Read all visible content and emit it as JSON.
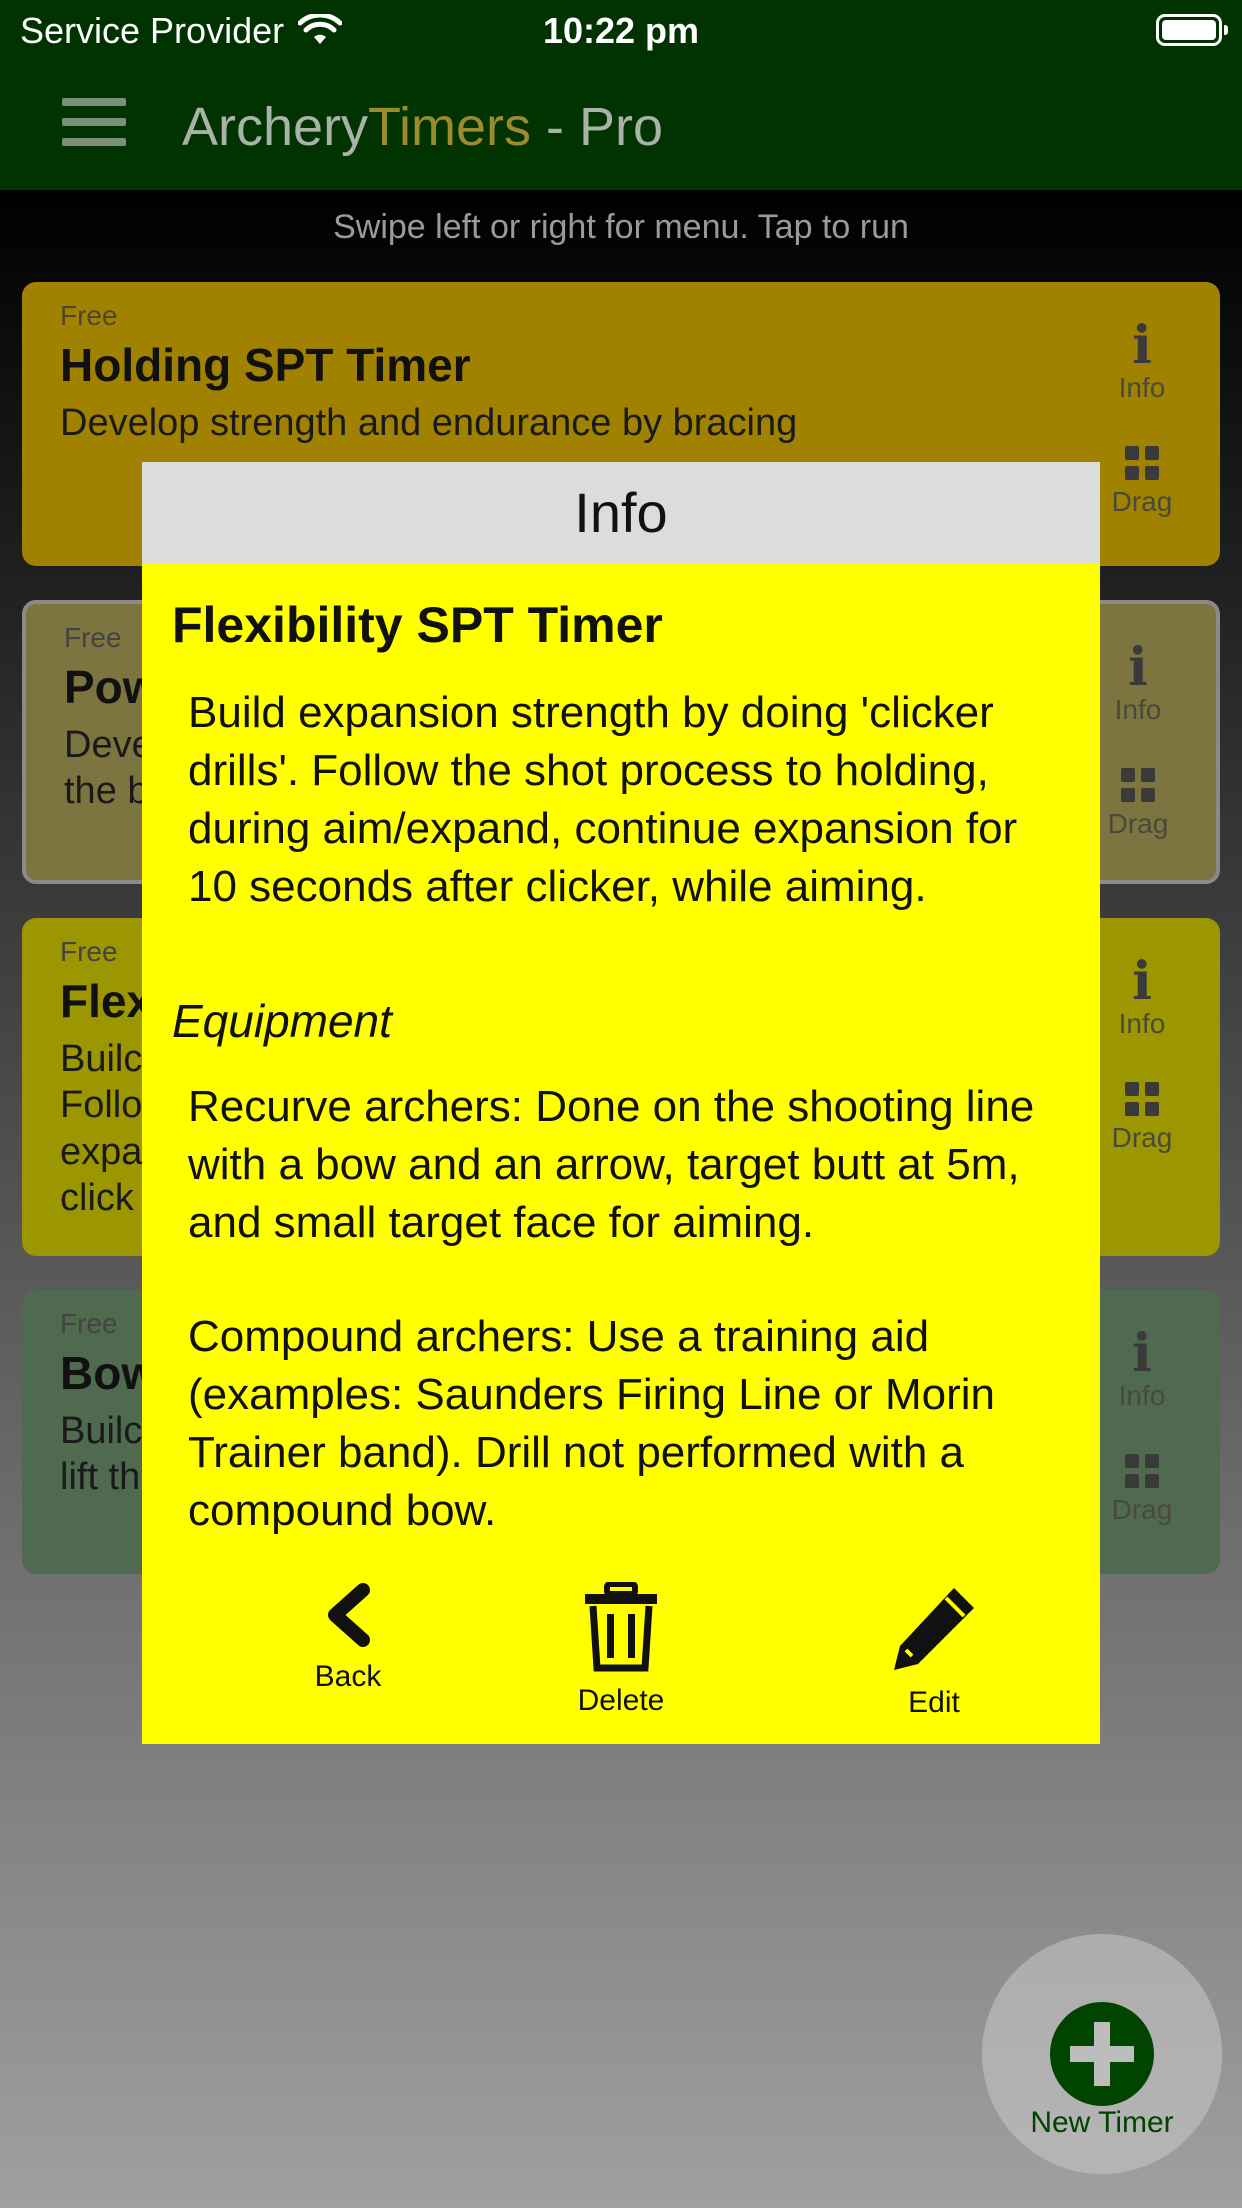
{
  "status_bar": {
    "carrier": "Service Provider",
    "time": "10:22 pm",
    "wifi_icon": "wifi-icon",
    "battery_icon": "battery-icon"
  },
  "header": {
    "title_part1": "Archery",
    "title_part2": "Timers",
    "title_part3": " - Pro",
    "menu_icon": "hamburger-menu-icon",
    "accent_color": "#9a8c2e",
    "bar_color": "#003300"
  },
  "hint": "Swipe left or right for menu. Tap to run",
  "cards": [
    {
      "tier": "Free",
      "name": "Holding SPT Timer",
      "desc": "Develop strength and endurance by bracing",
      "info_label": "Info",
      "drag_label": "Drag",
      "color": "#a08200"
    },
    {
      "tier": "Free",
      "name": "Pow",
      "desc": "Deve\nthe b",
      "info_label": "Info",
      "drag_label": "Drag",
      "color": "#7d7540"
    },
    {
      "tier": "Free",
      "name": "Flex",
      "desc": "Builc\nFollo\nexpa\nclick",
      "info_label": "Info",
      "drag_label": "Drag",
      "color": "#9c9700"
    },
    {
      "tier": "Free",
      "name": "Bow",
      "desc": "Builc\nlift th",
      "info_label": "Info",
      "drag_label": "Drag",
      "color": "#4f6a4f"
    }
  ],
  "modal": {
    "header": "Info",
    "title": "Flexibility SPT Timer",
    "description": "Build expansion strength by doing 'clicker drills'. Follow the shot process to holding, during aim/expand, continue expansion for 10 seconds after clicker, while aiming.",
    "equipment_heading": "Equipment",
    "recurve": "Recurve archers: Done on the shooting line with a bow and an arrow, target butt at 5m, and small target face for aiming.",
    "compound": "Compound archers: Use a training aid (examples: Saunders Firing Line or Morin Trainer band). Drill not performed with a compound bow.",
    "back_label": "Back",
    "delete_label": "Delete",
    "edit_label": "Edit",
    "background": "#ffff00"
  },
  "fab": {
    "label": "New Timer",
    "icon": "plus-icon"
  }
}
